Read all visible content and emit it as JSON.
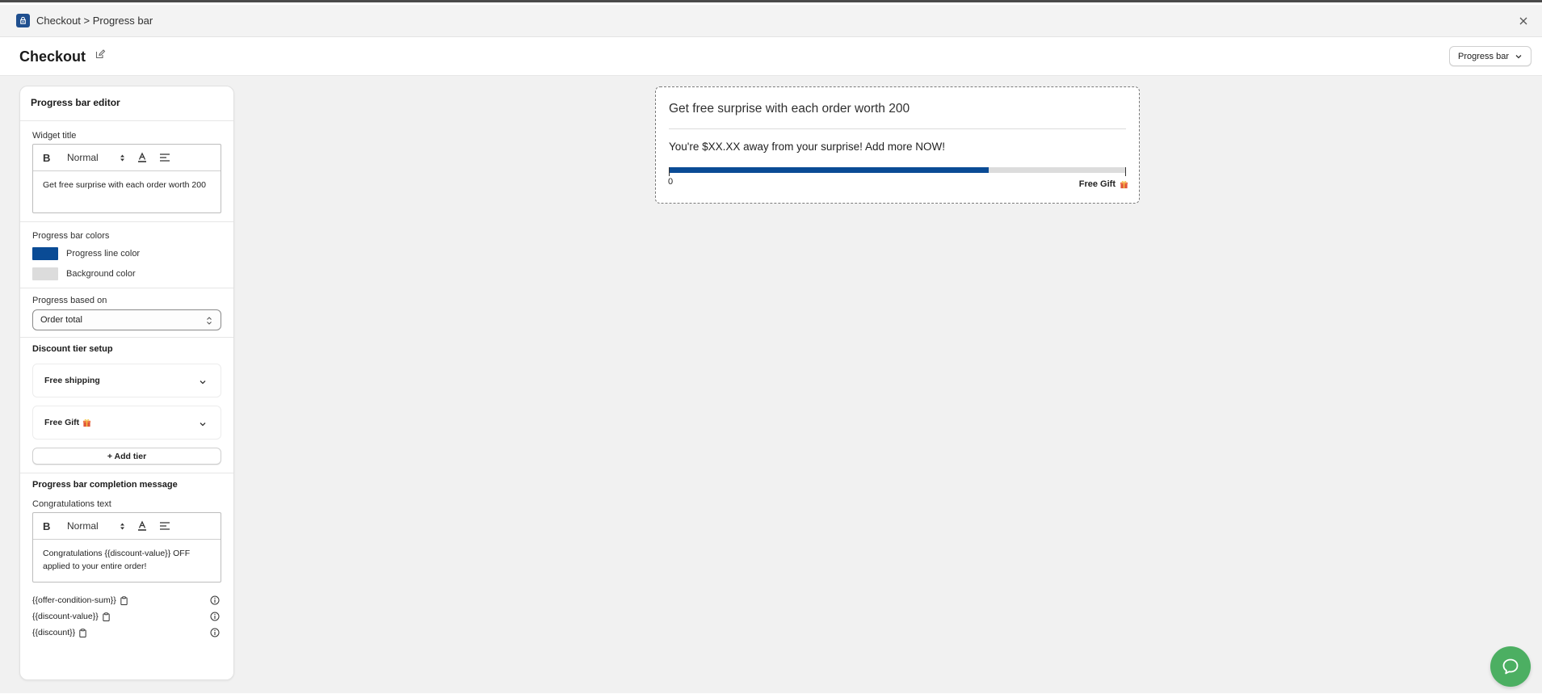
{
  "window": {
    "breadcrumb": "Checkout > Progress bar",
    "colors": {
      "brand": "#1f4f8f"
    }
  },
  "header": {
    "page_title": "Checkout",
    "view_select": "Progress bar"
  },
  "editor": {
    "title": "Progress bar editor",
    "widget_title": {
      "label": "Widget title",
      "font_size": "Normal",
      "text": "Get free surprise with each order worth 200"
    },
    "colors": {
      "section": "Progress bar colors",
      "progress_label": "Progress line color",
      "progress_value": "#0a4b95",
      "background_label": "Background color",
      "background_value": "#dcdcdc"
    },
    "progress_based_on": {
      "label": "Progress based on",
      "value": "Order total"
    },
    "discount_tiers": {
      "section": "Discount tier setup",
      "tiers": [
        {
          "label": "Free shipping"
        },
        {
          "label": "Free Gift"
        }
      ],
      "add_label": "+ Add tier"
    },
    "completion": {
      "section": "Progress bar completion message",
      "label": "Congratulations text",
      "font_size": "Normal",
      "text": "Congratulations {{discount-value}} OFF applied to your entire order!"
    },
    "variables": [
      "{{offer-condition-sum}}",
      "{{discount-value}}",
      "{{discount}}"
    ]
  },
  "preview": {
    "title": "Get free surprise with each order worth 200",
    "message": "You're $XX.XX away from your surprise! Add more NOW!",
    "progress_fraction": 0.7,
    "start_label": "0",
    "goal_label": "Free Gift"
  },
  "chat": {
    "icon": "chat-bubble-icon",
    "color": "#4caf62"
  }
}
